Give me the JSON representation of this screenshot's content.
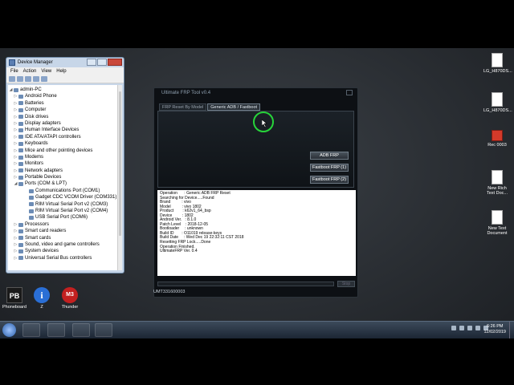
{
  "device_manager": {
    "title": "Device Manager",
    "menu": [
      "File",
      "Action",
      "View",
      "Help"
    ],
    "tree": [
      {
        "label": "admin-PC",
        "level": 0,
        "exp": "◢"
      },
      {
        "label": "Android Phone",
        "level": 1,
        "exp": "▷"
      },
      {
        "label": "Batteries",
        "level": 1,
        "exp": "▷"
      },
      {
        "label": "Computer",
        "level": 1,
        "exp": "▷"
      },
      {
        "label": "Disk drives",
        "level": 1,
        "exp": "▷"
      },
      {
        "label": "Display adapters",
        "level": 1,
        "exp": "▷"
      },
      {
        "label": "Human Interface Devices",
        "level": 1,
        "exp": "▷"
      },
      {
        "label": "IDE ATA/ATAPI controllers",
        "level": 1,
        "exp": "▷"
      },
      {
        "label": "Keyboards",
        "level": 1,
        "exp": "▷"
      },
      {
        "label": "Mice and other pointing devices",
        "level": 1,
        "exp": "▷"
      },
      {
        "label": "Modems",
        "level": 1,
        "exp": "▷"
      },
      {
        "label": "Monitors",
        "level": 1,
        "exp": "▷"
      },
      {
        "label": "Network adapters",
        "level": 1,
        "exp": "▷"
      },
      {
        "label": "Portable Devices",
        "level": 1,
        "exp": "▷"
      },
      {
        "label": "Ports (COM & LPT)",
        "level": 1,
        "exp": "◢"
      },
      {
        "label": "Communications Port (COM1)",
        "level": 2,
        "exp": ""
      },
      {
        "label": "Gadget CDC VCOM Driver (COM331)",
        "level": 2,
        "exp": ""
      },
      {
        "label": "RIM Virtual Serial Port v2 (COM3)",
        "level": 2,
        "exp": ""
      },
      {
        "label": "RIM Virtual Serial Port v2 (COM4)",
        "level": 2,
        "exp": ""
      },
      {
        "label": "USB Serial Port (COM6)",
        "level": 2,
        "exp": ""
      },
      {
        "label": "Processors",
        "level": 1,
        "exp": "▷"
      },
      {
        "label": "Smart card readers",
        "level": 1,
        "exp": "▷"
      },
      {
        "label": "Smart cards",
        "level": 1,
        "exp": "▷"
      },
      {
        "label": "Sound, video and game controllers",
        "level": 1,
        "exp": "▷"
      },
      {
        "label": "System devices",
        "level": 1,
        "exp": "▷"
      },
      {
        "label": "Universal Serial Bus controllers",
        "level": 1,
        "exp": "▷"
      }
    ]
  },
  "desktop_icons": {
    "right": [
      {
        "label": "LG_H870DS..."
      },
      {
        "label": "LG_H870DS..."
      },
      {
        "label": "Rec 0003"
      },
      {
        "label": "New Rich Text Doc..."
      },
      {
        "label": "New Text Document"
      }
    ],
    "left": [
      {
        "label": "Phoneboard",
        "icon_text": "PB"
      },
      {
        "label": "Z",
        "icon_text": "i"
      },
      {
        "label": "Thunder",
        "icon_text": "M3"
      }
    ]
  },
  "frp_tool": {
    "title": "Ultimate FRP Tool v0.4",
    "tabs": [
      "FRP Reset By Model",
      "Generic ADB / Fastboot"
    ],
    "active_tab": 1,
    "buttons": [
      "ADB FRP",
      "Fastboot FRP (1)",
      "Fastboot FRP (2)"
    ],
    "log": [
      "Operation      : Generic ADB FRP Reset",
      "Searching for Device.....Found",
      "Brand          : vivo",
      "Model          : vivo 1802",
      "Product        : k62v1_64_bsp",
      "Device         : 1802",
      "Android Ver.   : 8.1.0",
      "Patch Level    : 2018-12-05",
      "Bootloader     : unknown",
      "Build ID       : O11019 release-keys",
      "Build Date     : Wed Dec 19 22:32:11 CST 2018",
      "Resetting FRP Lock.....Done",
      "Operation Finished.",
      "UltimateFRP Ver. 0.4"
    ],
    "stop_label": "Stop",
    "status": "UMT331600003"
  },
  "taskbar": {
    "time": "6:26 PM",
    "date": "12/02/2019"
  },
  "colors": {
    "accent_ring": "#27d43a",
    "desktop_bg": "#2a2e33"
  }
}
